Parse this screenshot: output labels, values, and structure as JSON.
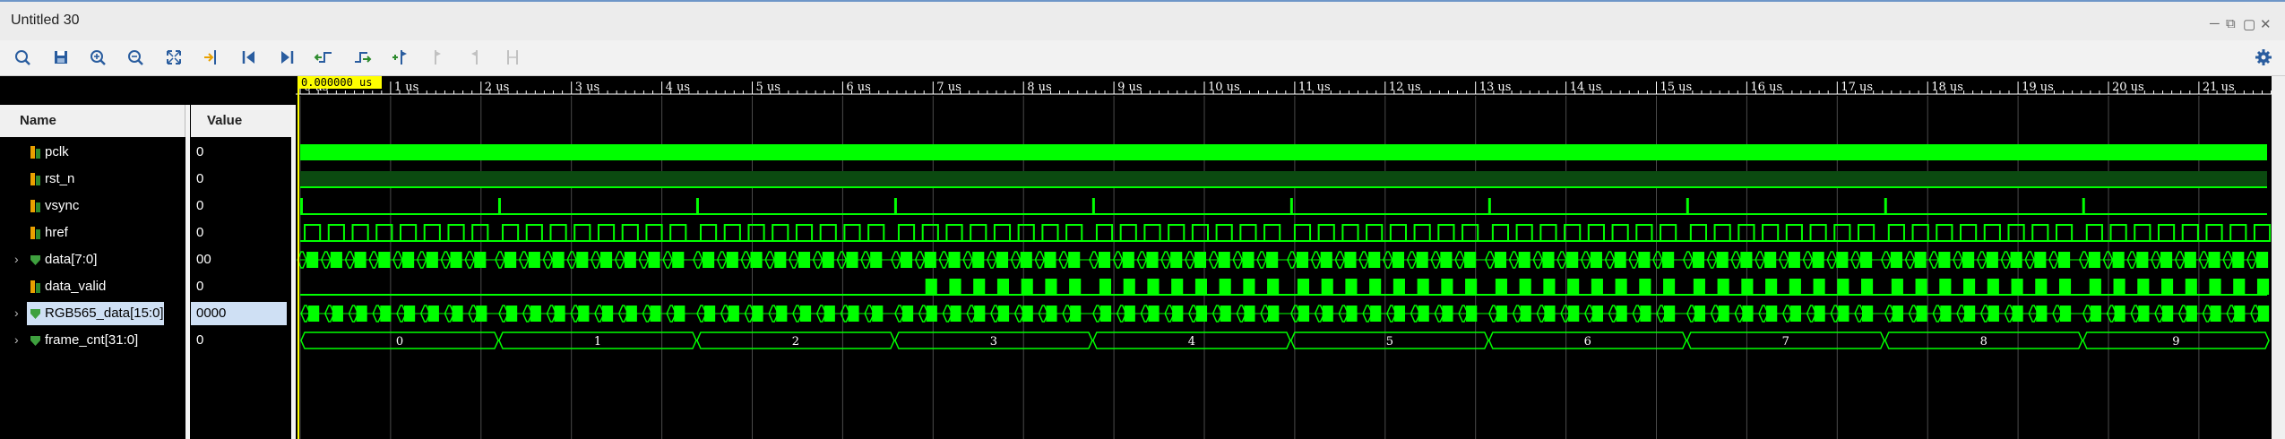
{
  "window": {
    "title": "Untitled 30",
    "minimize": "─",
    "restore": "⧉",
    "maximize": "▢",
    "close": "✕"
  },
  "toolbar": {
    "buttons": [
      {
        "name": "search-icon",
        "disabled": false
      },
      {
        "name": "save-icon",
        "disabled": false
      },
      {
        "name": "zoom-in-icon",
        "disabled": false
      },
      {
        "name": "zoom-out-icon",
        "disabled": false
      },
      {
        "name": "zoom-fit-icon",
        "disabled": false
      },
      {
        "name": "go-to-cursor-icon",
        "disabled": false
      },
      {
        "name": "go-to-time-zero-icon",
        "disabled": false
      },
      {
        "name": "go-to-last-time-icon",
        "disabled": false
      },
      {
        "name": "previous-transition-icon",
        "disabled": false
      },
      {
        "name": "next-transition-icon",
        "disabled": false
      },
      {
        "name": "add-marker-icon",
        "disabled": false
      },
      {
        "name": "previous-marker-icon",
        "disabled": true
      },
      {
        "name": "next-marker-icon",
        "disabled": true
      },
      {
        "name": "swap-cursors-icon",
        "disabled": true
      }
    ],
    "settings_icon": "gear-icon"
  },
  "columns": {
    "name": "Name",
    "value": "Value"
  },
  "signals": [
    {
      "label": "pclk",
      "value": "0",
      "type": "bit",
      "expandable": false,
      "selected": false
    },
    {
      "label": "rst_n",
      "value": "0",
      "type": "bit",
      "expandable": false,
      "selected": false
    },
    {
      "label": "vsync",
      "value": "0",
      "type": "bit",
      "expandable": false,
      "selected": false
    },
    {
      "label": "href",
      "value": "0",
      "type": "bit",
      "expandable": false,
      "selected": false
    },
    {
      "label": "data[7:0]",
      "value": "00",
      "type": "bus",
      "expandable": true,
      "selected": false
    },
    {
      "label": "data_valid",
      "value": "0",
      "type": "bit",
      "expandable": false,
      "selected": false
    },
    {
      "label": "RGB565_data[15:0]",
      "value": "0000",
      "type": "bus",
      "expandable": true,
      "selected": true
    },
    {
      "label": "frame_cnt[31:0]",
      "value": "0",
      "type": "bus",
      "expandable": true,
      "selected": false
    }
  ],
  "cursor": {
    "time_label": "0.000000 us"
  },
  "timeline": {
    "tick_labels": [
      "0 us",
      "1 us",
      "2 us",
      "3 us",
      "4 us",
      "5 us",
      "6 us",
      "7 us",
      "8 us",
      "9 us",
      "10 us",
      "11 us",
      "12 us",
      "13 us",
      "14 us",
      "15 us",
      "16 us",
      "17 us",
      "18 us",
      "19 us",
      "20 us",
      "21 us"
    ],
    "start_us": 0,
    "end_us": 21.9
  },
  "frame_cnt_values": [
    "0",
    "1",
    "2",
    "3",
    "4",
    "5",
    "6",
    "7",
    "8",
    "9"
  ],
  "colors": {
    "wave": "#00ff00",
    "background": "#000000",
    "cursor": "#ffff00",
    "grid": "#4a4a4a"
  }
}
